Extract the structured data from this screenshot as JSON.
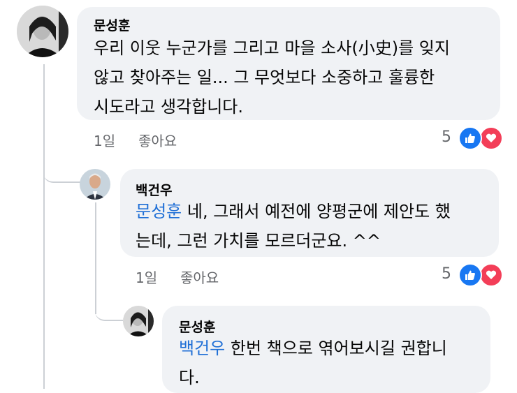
{
  "comments": [
    {
      "author": "문성훈",
      "text_lines": [
        "우리 이웃 누군가를 그리고 마을 소사(小史)를 잊지",
        "않고 찾아주는 일...  그 무엇보다 소중하고 훌륭한",
        "시도라고 생각합니다."
      ],
      "time": "1일",
      "like_label": "좋아요",
      "reaction_count": "5",
      "reaction_icons": [
        "like-icon",
        "love-icon"
      ]
    },
    {
      "author": "백건우",
      "mention": "문성훈",
      "text_first_rest": " 네, 그래서 예전에 양평군에 제안도 했",
      "text_lines": [
        "는데, 그런 가치를 모르더군요. ^^"
      ],
      "time": "1일",
      "like_label": "좋아요",
      "reaction_count": "5",
      "reaction_icons": [
        "like-icon",
        "love-icon"
      ]
    },
    {
      "author": "문성훈",
      "mention": "백건우",
      "text_first_rest": " 한번 책으로 엮어보시길 권합니",
      "text_lines": [
        "다."
      ]
    }
  ],
  "colors": {
    "mention": "#1f6fd6",
    "like": "#1877f2",
    "love": "#f33e58",
    "bubble": "#f0f2f5"
  }
}
